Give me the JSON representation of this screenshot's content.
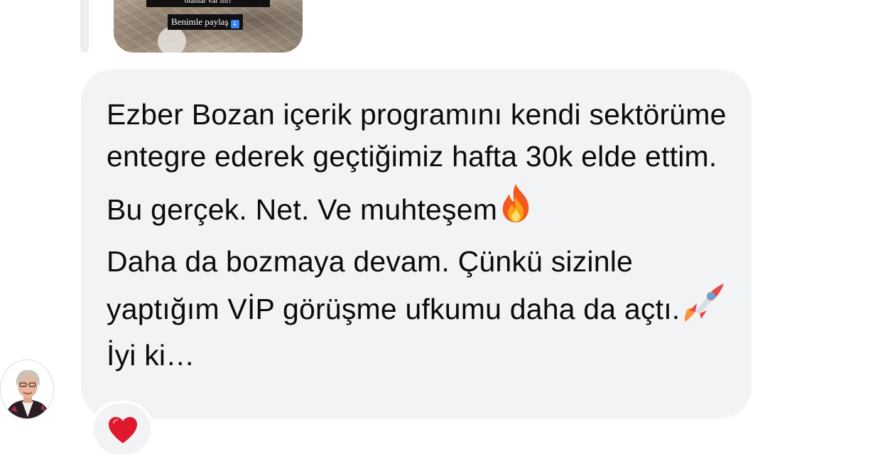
{
  "story_reply": {
    "caption_partial": "olanlar var mı?",
    "share_label": "Benimle paylaş",
    "share_icon": "down-arrow-emoji"
  },
  "message": {
    "paragraph_1": "Ezber Bozan içerik programını kendi sektörüme entegre ederek geçtiğimiz hafta 30k elde ettim.",
    "paragraph_2": "Bu gerçek. Net. Ve muhteşem",
    "paragraph_2_emoji": "fire-emoji",
    "paragraph_3a": "Daha da bozmaya devam. Çünkü sizinle yaptığım VİP görüşme ufkumu daha da açtı.",
    "paragraph_3_emoji": "rocket-emoji",
    "paragraph_3b": "İyi ki…"
  },
  "sender": {
    "avatar": "profile-photo"
  },
  "reaction": {
    "icon": "red-heart-emoji",
    "color": "#e0182d"
  },
  "colors": {
    "bubble_bg": "#f2f3f5",
    "text": "#0b0b0b"
  }
}
